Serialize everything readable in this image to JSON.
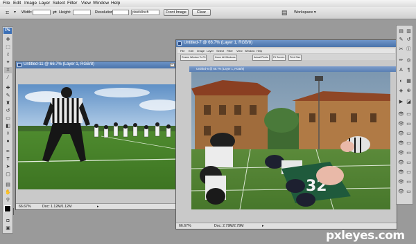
{
  "menubar": {
    "items": [
      "File",
      "Edit",
      "Image",
      "Layer",
      "Select",
      "Filter",
      "View",
      "Window",
      "Help"
    ]
  },
  "options": {
    "width_label": "Width:",
    "height_label": "Height:",
    "resolution_label": "Resolution:",
    "units_value": "pixels/inch",
    "front_image_label": "Front Image",
    "clear_label": "Clear",
    "workspace_label": "Workspace ▾"
  },
  "window1": {
    "title": "Untitled-11 @ 66.7% (Layer 1, RGB/8)",
    "zoom": "66.67%",
    "doc_info": "Doc: 1.12M/1.12M"
  },
  "window2": {
    "title": "Untitled-7 @ 66.7% (Layer 1, RGB/8)",
    "zoom": "66.67%",
    "doc_info": "Doc: 2.79M/2.79M",
    "inner_title": "Untitled-6 @ 66.7% (Layer 1, RGB/8)",
    "inner_menu": [
      "File",
      "Edit",
      "Image",
      "Layer",
      "Select",
      "Filter",
      "View",
      "Window",
      "Help"
    ],
    "inner_buttons": [
      "Resize Window To Fit",
      "Zoom All Windows",
      "Actual Pixels",
      "Fit Screen",
      "Print Size"
    ]
  },
  "watermark": "pxleyes.com",
  "colors": {
    "titlebar": "#5a82b8",
    "chrome": "#d6d6d6",
    "background": "#9a9a9a"
  }
}
